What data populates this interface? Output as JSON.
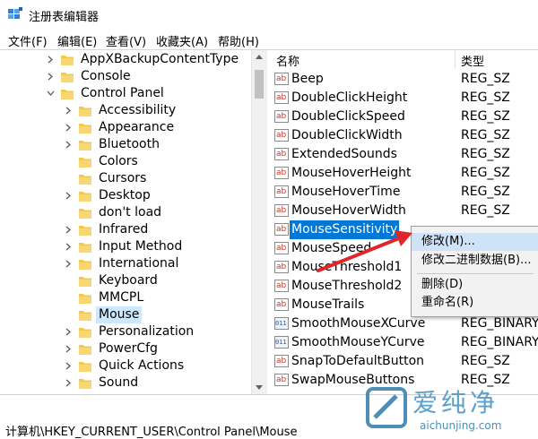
{
  "window": {
    "title": "注册表编辑器"
  },
  "menu": [
    "文件(F)",
    "编辑(E)",
    "查看(V)",
    "收藏夹(A)",
    "帮助(H)"
  ],
  "tree": {
    "items": [
      {
        "label": "AppXBackupContentType",
        "level": 2,
        "expander": "right"
      },
      {
        "label": "Console",
        "level": 2,
        "expander": "right"
      },
      {
        "label": "Control Panel",
        "level": 2,
        "expander": "down"
      },
      {
        "label": "Accessibility",
        "level": 3,
        "expander": "right"
      },
      {
        "label": "Appearance",
        "level": 3,
        "expander": "right"
      },
      {
        "label": "Bluetooth",
        "level": 3,
        "expander": "right"
      },
      {
        "label": "Colors",
        "level": 3,
        "expander": "none"
      },
      {
        "label": "Cursors",
        "level": 3,
        "expander": "none"
      },
      {
        "label": "Desktop",
        "level": 3,
        "expander": "right"
      },
      {
        "label": "don't load",
        "level": 3,
        "expander": "none"
      },
      {
        "label": "Infrared",
        "level": 3,
        "expander": "right"
      },
      {
        "label": "Input Method",
        "level": 3,
        "expander": "right"
      },
      {
        "label": "International",
        "level": 3,
        "expander": "right"
      },
      {
        "label": "Keyboard",
        "level": 3,
        "expander": "none"
      },
      {
        "label": "MMCPL",
        "level": 3,
        "expander": "none"
      },
      {
        "label": "Mouse",
        "level": 3,
        "expander": "none",
        "selected": true
      },
      {
        "label": "Personalization",
        "level": 3,
        "expander": "right"
      },
      {
        "label": "PowerCfg",
        "level": 3,
        "expander": "right"
      },
      {
        "label": "Quick Actions",
        "level": 3,
        "expander": "right"
      },
      {
        "label": "Sound",
        "level": 3,
        "expander": "right"
      }
    ]
  },
  "list": {
    "columns": {
      "name": "名称",
      "type": "类型"
    },
    "rows": [
      {
        "name": "Beep",
        "type": "REG_SZ",
        "icon": "string-value-icon"
      },
      {
        "name": "DoubleClickHeight",
        "type": "REG_SZ",
        "icon": "string-value-icon"
      },
      {
        "name": "DoubleClickSpeed",
        "type": "REG_SZ",
        "icon": "string-value-icon"
      },
      {
        "name": "DoubleClickWidth",
        "type": "REG_SZ",
        "icon": "string-value-icon"
      },
      {
        "name": "ExtendedSounds",
        "type": "REG_SZ",
        "icon": "string-value-icon"
      },
      {
        "name": "MouseHoverHeight",
        "type": "REG_SZ",
        "icon": "string-value-icon"
      },
      {
        "name": "MouseHoverTime",
        "type": "REG_SZ",
        "icon": "string-value-icon"
      },
      {
        "name": "MouseHoverWidth",
        "type": "REG_SZ",
        "icon": "string-value-icon"
      },
      {
        "name": "MouseSensitivity",
        "type": "",
        "icon": "string-value-icon",
        "selected": true
      },
      {
        "name": "MouseSpeed",
        "type": "",
        "icon": "string-value-icon"
      },
      {
        "name": "MouseThreshold1",
        "type": "",
        "icon": "string-value-icon"
      },
      {
        "name": "MouseThreshold2",
        "type": "",
        "icon": "string-value-icon"
      },
      {
        "name": "MouseTrails",
        "type": "",
        "icon": "string-value-icon"
      },
      {
        "name": "SmoothMouseXCurve",
        "type": "REG_BINARY",
        "icon": "binary-value-icon"
      },
      {
        "name": "SmoothMouseYCurve",
        "type": "REG_BINARY",
        "icon": "binary-value-icon"
      },
      {
        "name": "SnapToDefaultButton",
        "type": "REG_SZ",
        "icon": "string-value-icon"
      },
      {
        "name": "SwapMouseButtons",
        "type": "REG_SZ",
        "icon": "string-value-icon"
      }
    ]
  },
  "context_menu": {
    "items": [
      "修改(M)...",
      "修改二进制数据(B)...",
      "删除(D)",
      "重命名(R)"
    ],
    "highlighted": "修改(M)..."
  },
  "status": {
    "path": "计算机\\HKEY_CURRENT_USER\\Control Panel\\Mouse"
  },
  "watermark": {
    "text": "爱纯净",
    "url": "aichunjing.com"
  },
  "colors": {
    "selection": "#0078d7",
    "arrow": "#e0262b",
    "folder": "#f2c94c"
  }
}
